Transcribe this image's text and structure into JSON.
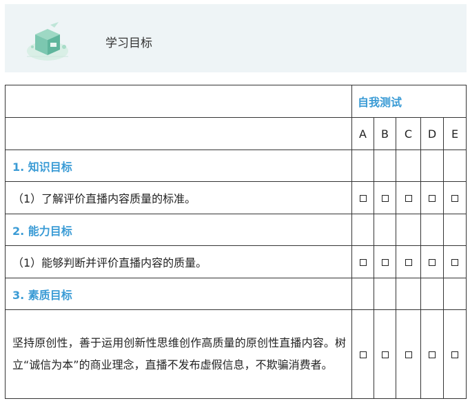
{
  "header": {
    "title": "学习目标",
    "icon": "box-illustration-icon"
  },
  "table": {
    "self_test_label": "自我测试",
    "letters": [
      "A",
      "B",
      "C",
      "D",
      "E"
    ],
    "sections": [
      {
        "title": "1. 知识目标",
        "item": "（1）了解评价直播内容质量的标准。"
      },
      {
        "title": "2. 能力目标",
        "item": "（1）能够判断并评价直播内容的质量。"
      },
      {
        "title": "3. 素质目标",
        "item": "坚持原创性，善于运用创新性思维创作高质量的原创性直播内容。树立“诚信为本”的商业理念，直播不发布虚假信息，不欺骗消费者。"
      }
    ]
  },
  "colors": {
    "accent": "#3a9bd5",
    "header_bg": "#eef4f6"
  }
}
